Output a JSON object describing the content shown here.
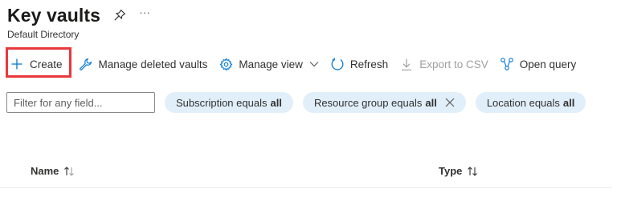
{
  "header": {
    "title": "Key vaults",
    "subtitle": "Default Directory",
    "more_label": "···"
  },
  "toolbar": {
    "create_label": "Create",
    "manage_deleted_label": "Manage deleted vaults",
    "manage_view_label": "Manage view",
    "refresh_label": "Refresh",
    "export_label": "Export to CSV",
    "open_query_label": "Open query"
  },
  "filters": {
    "search_placeholder": "Filter for any field...",
    "subscription_label": "Subscription equals",
    "subscription_value": "all",
    "resource_group_label": "Resource group equals",
    "resource_group_value": "all",
    "location_label": "Location equals",
    "location_value": "all"
  },
  "table": {
    "columns": [
      {
        "label": "Name"
      },
      {
        "label": "Type"
      }
    ]
  },
  "colors": {
    "accent": "#0078d4",
    "pill_bg": "#e1effa",
    "highlight": "#e8383d",
    "disabled": "#a19f9d"
  },
  "icons": [
    "pin-icon",
    "plus-icon",
    "wrench-icon",
    "gear-icon",
    "chevron-down-icon",
    "refresh-icon",
    "download-icon",
    "query-icon",
    "close-icon",
    "sort-icon"
  ]
}
